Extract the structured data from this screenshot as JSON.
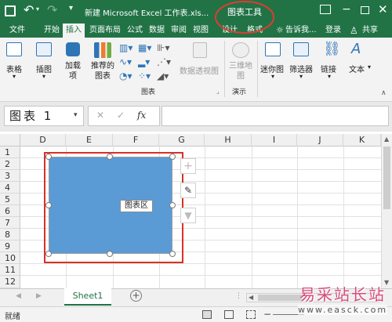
{
  "titlebar": {
    "save_icon": "save-icon",
    "undo_icon": "undo-icon",
    "redo_icon": "redo-icon",
    "title": "新建 Microsoft Excel 工作表.xls...",
    "context_title": "图表工具",
    "accent": "#217346",
    "highlight_circle": "#e03c31"
  },
  "tabs": {
    "file": "文件",
    "home": "开始",
    "insert": "插入",
    "page_layout": "页面布局",
    "formulas": "公式",
    "data": "数据",
    "review": "审阅",
    "view": "视图",
    "design": "设计",
    "format": "格式",
    "tell_me": "告诉我...",
    "login": "登录",
    "share": "共享"
  },
  "ribbon": {
    "table": "表格",
    "illustrations": "插图",
    "addins": "加载\n项",
    "recommended_charts": "推荐的\n图表",
    "pivot_chart": "数据透视图",
    "map_3d": "三维地\n图",
    "sparklines": "迷你图",
    "filters": "筛选器",
    "link": "链接",
    "text": "文本",
    "group_charts": "图表",
    "group_tours": "演示"
  },
  "formula": {
    "name_box": "图表 1",
    "fx_label": "fx"
  },
  "columns": [
    "D",
    "E",
    "F",
    "G",
    "H",
    "I",
    "J",
    "K"
  ],
  "rows": [
    "1",
    "2",
    "3",
    "4",
    "5",
    "6",
    "7",
    "8",
    "9",
    "10",
    "11",
    "12"
  ],
  "chart": {
    "fill_color": "#5b9bd5",
    "tooltip": "图表区",
    "border_color": "#d93025"
  },
  "sheets": {
    "tab": "Sheet1"
  },
  "status": {
    "ready": "就绪"
  },
  "watermark": {
    "brand": "易采站长站",
    "url": "www.easck.com"
  }
}
